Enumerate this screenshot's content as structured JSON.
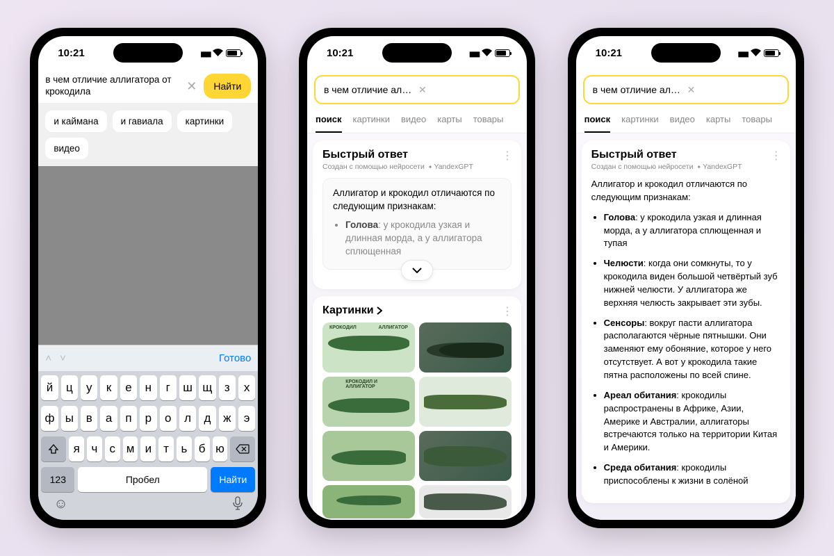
{
  "status": {
    "time": "10:21"
  },
  "phone1": {
    "query": "в чем отличие аллигатора от крокодила",
    "find": "Найти",
    "chips": [
      "и каймана",
      "и гавиала",
      "картинки",
      "видео"
    ],
    "kb_done": "Готово",
    "kb_rows": [
      [
        "й",
        "ц",
        "у",
        "к",
        "е",
        "н",
        "г",
        "ш",
        "щ",
        "з",
        "х"
      ],
      [
        "ф",
        "ы",
        "в",
        "а",
        "п",
        "р",
        "о",
        "л",
        "д",
        "ж",
        "э"
      ],
      [
        "я",
        "ч",
        "с",
        "м",
        "и",
        "т",
        "ь",
        "б",
        "ю"
      ]
    ],
    "kb_num": "123",
    "kb_space": "Пробел",
    "kb_enter": "Найти"
  },
  "search": {
    "query_trunc": "в чем отличие аллигатора от кр...",
    "tabs": [
      "поиск",
      "картинки",
      "видео",
      "карты",
      "товары"
    ]
  },
  "answer": {
    "title": "Быстрый ответ",
    "subtitle_prefix": "Создан с помощью нейросети",
    "subtitle_brand": "YandexGPT",
    "intro": "Аллигатор и крокодил отличаются по следующим признакам:",
    "bullet_preview_label": "Голова",
    "bullet_preview_text": ": у крокодила узкая и длинная морда, а у аллигатора сплющенная",
    "bullets": [
      {
        "label": "Голова",
        "text": ": у крокодила узкая и длинная морда, а у аллигатора сплющенная и тупая"
      },
      {
        "label": "Челюсти",
        "text": ": когда они сомкнуты, то у крокодила виден большой четвёртый зуб нижней челюсти. У аллигатора же верхняя челюсть закрывает эти зубы."
      },
      {
        "label": "Сенсоры",
        "text": ": вокруг пасти аллигатора располагаются чёрные пятнышки. Они заменяют ему обоняние, которое у него отсутствует. А вот у крокодила такие пятна расположены по всей спине."
      },
      {
        "label": "Ареал обитания",
        "text": ": крокодилы распространены в Африке, Азии, Америке и Австралии, аллигаторы встречаются только на территории Китая и Америки."
      },
      {
        "label": "Среда обитания",
        "text": ": крокодилы приспособлены к жизни в солёной"
      }
    ]
  },
  "pics": {
    "title": "Картинки",
    "labels": {
      "croc": "КРОКОДИЛ",
      "alli": "АЛЛИГАТОР",
      "compare": "КРОКОДИЛ И АЛЛИГАТОР"
    }
  }
}
